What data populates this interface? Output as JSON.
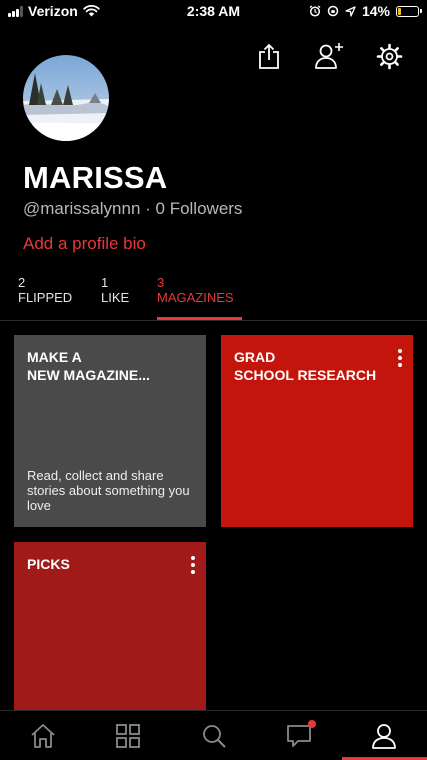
{
  "status_bar": {
    "carrier": "Verizon",
    "time": "2:38 AM",
    "battery": "14%",
    "battery_level": 0.14,
    "icons": [
      "signal-icon",
      "wifi-icon",
      "alarm-icon",
      "orientation-lock-icon",
      "location-icon",
      "battery-icon"
    ]
  },
  "header": {
    "actions": [
      "share-icon",
      "add-user-icon",
      "settings-icon"
    ]
  },
  "profile": {
    "name": "MARISSA",
    "handle": "@marissalynnn",
    "followers": "0 Followers",
    "separator": " · ",
    "bio_link": "Add a profile bio"
  },
  "tabs": [
    {
      "count": "2",
      "label": "FLIPPED"
    },
    {
      "count": "1",
      "label": "LIKE"
    },
    {
      "count": "3",
      "label": "MAGAZINES",
      "active": true
    }
  ],
  "tiles": [
    {
      "title": "MAKE A\nNEW MAGAZINE...",
      "desc": "Read, collect and share stories about something you love",
      "color": "#4a4a4a"
    },
    {
      "title": "GRAD\nSCHOOL RESEARCH",
      "color": "#c4150d"
    },
    {
      "title": "PICKS",
      "color": "#a01a1a"
    }
  ],
  "bottom_nav": [
    "home-icon",
    "grid-icon",
    "search-icon",
    "notifications-icon",
    "profile-icon"
  ],
  "colors": {
    "accent": "#e8393a",
    "background": "#000000"
  }
}
